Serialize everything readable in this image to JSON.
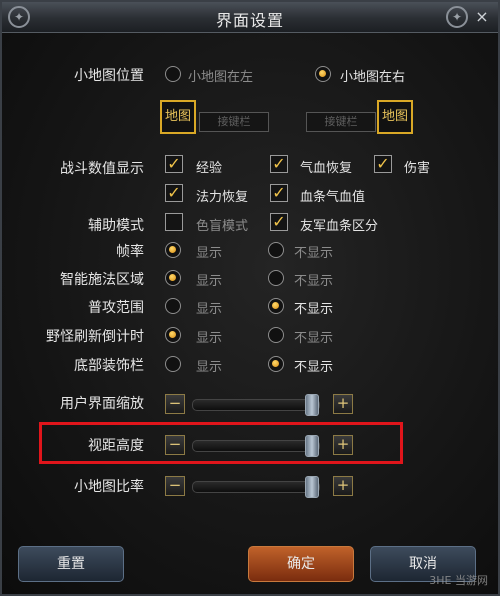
{
  "window": {
    "title": "界面设置",
    "close_icon": "×"
  },
  "minimap_position": {
    "label": "小地图位置",
    "options": [
      "小地图在左",
      "小地图在右"
    ],
    "selected": 1,
    "map_box_label": "地图",
    "hotkey_label": "接键栏"
  },
  "combat_display": {
    "label": "战斗数值显示",
    "items": [
      {
        "label": "经验",
        "checked": true
      },
      {
        "label": "气血恢复",
        "checked": true
      },
      {
        "label": "伤害",
        "checked": true
      },
      {
        "label": "法力恢复",
        "checked": true
      },
      {
        "label": "血条气血值",
        "checked": true
      }
    ]
  },
  "assist_mode": {
    "label": "辅助模式",
    "items": [
      {
        "label": "色盲模式",
        "checked": false
      },
      {
        "label": "友军血条区分",
        "checked": true
      }
    ]
  },
  "radio_rows": [
    {
      "label": "帧率",
      "selected": 0
    },
    {
      "label": "智能施法区域",
      "selected": 0
    },
    {
      "label": "普攻范围",
      "selected": 1
    },
    {
      "label": "野怪刷新倒计时",
      "selected": 0
    },
    {
      "label": "底部装饰栏",
      "selected": 1
    }
  ],
  "radio_options": [
    "显示",
    "不显示"
  ],
  "sliders": [
    {
      "label": "用户界面缩放",
      "value_fraction": 0.95
    },
    {
      "label": "视距高度",
      "value_fraction": 0.95
    },
    {
      "label": "小地图比率",
      "value_fraction": 0.95
    }
  ],
  "slider_minus": "−",
  "slider_plus": "+",
  "buttons": {
    "reset": "重置",
    "confirm": "确定",
    "cancel": "取消"
  },
  "watermark": "3HE 当游网",
  "colors": {
    "highlight": "#e0151b",
    "accent": "#e8b634",
    "confirm_button": "#b5551f"
  }
}
